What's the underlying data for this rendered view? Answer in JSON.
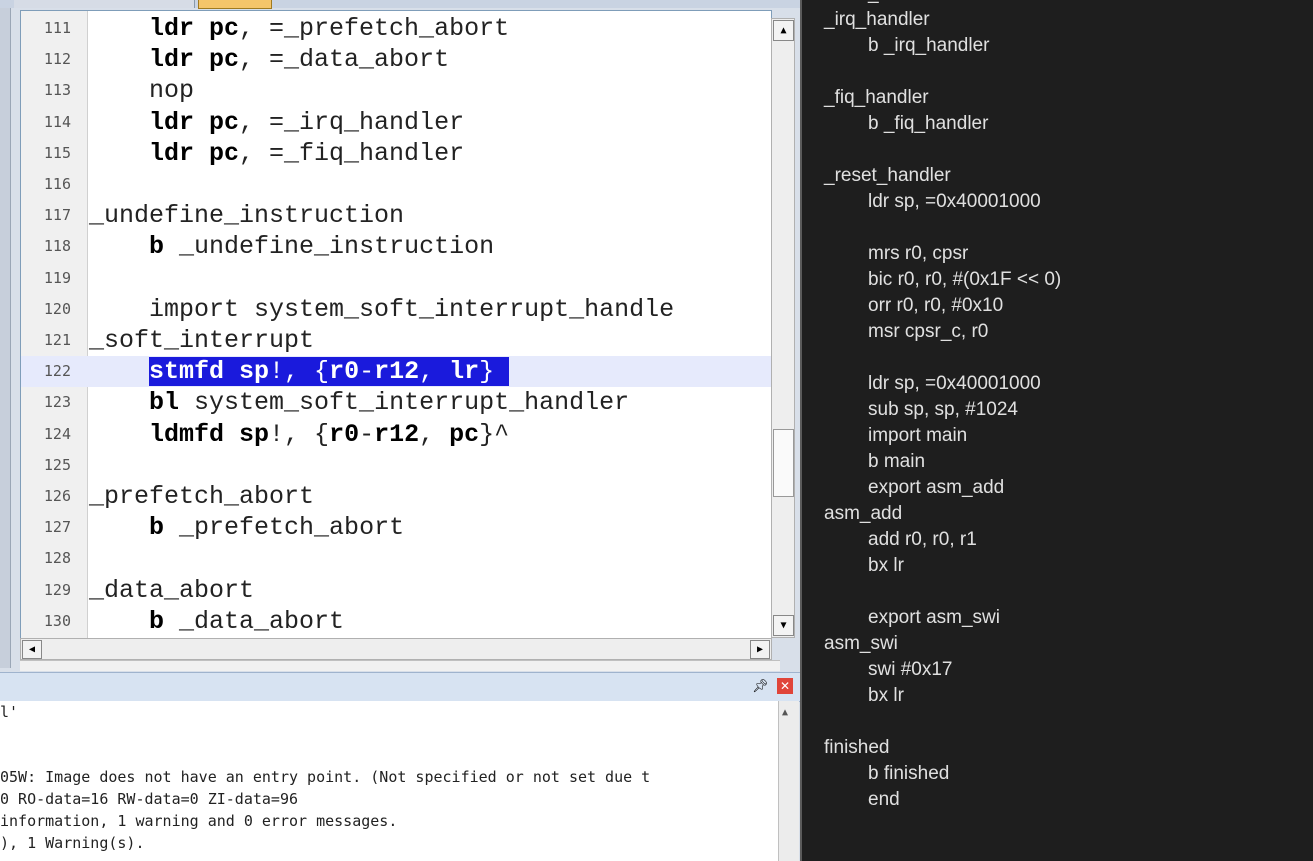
{
  "editor": {
    "lines": [
      {
        "num": "111",
        "html": "    <b>ldr pc</b>, =_prefetch_abort"
      },
      {
        "num": "112",
        "html": "    <b>ldr pc</b>, =_data_abort"
      },
      {
        "num": "113",
        "html": "    nop"
      },
      {
        "num": "114",
        "html": "    <b>ldr pc</b>, =_irq_handler"
      },
      {
        "num": "115",
        "html": "    <b>ldr pc</b>, =_fiq_handler"
      },
      {
        "num": "116",
        "html": ""
      },
      {
        "num": "117",
        "html": "_undefine_instruction"
      },
      {
        "num": "118",
        "html": "    <b>b</b> _undefine_instruction"
      },
      {
        "num": "119",
        "html": ""
      },
      {
        "num": "120",
        "html": "    import system_soft_interrupt_handle"
      },
      {
        "num": "121",
        "html": "_soft_interrupt"
      },
      {
        "num": "122",
        "html": "    <span class=\"sel\"><b>stmfd sp</b>!, {<b>r0</b>-<b>r12</b>, <b>lr</b>} </span>"
      },
      {
        "num": "123",
        "html": "    <b>bl</b> system_soft_interrupt_handler"
      },
      {
        "num": "124",
        "html": "    <b>ldmfd sp</b>!, {<b>r0</b>-<b>r12</b>, <b>pc</b>}^"
      },
      {
        "num": "125",
        "html": ""
      },
      {
        "num": "126",
        "html": "_prefetch_abort"
      },
      {
        "num": "127",
        "html": "    <b>b</b> _prefetch_abort"
      },
      {
        "num": "128",
        "html": ""
      },
      {
        "num": "129",
        "html": "_data_abort"
      },
      {
        "num": "130",
        "html": "    <b>b</b> _data_abort"
      }
    ]
  },
  "build_output": {
    "lines": [
      "l'",
      "",
      "",
      "05W: Image does not have an entry point. (Not specified or not set due t",
      "0 RO-data=16 RW-data=0 ZI-data=96",
      "information, 1 warning and 0 error messages.",
      "), 1 Warning(s)."
    ]
  },
  "notes": {
    "lines": [
      {
        "indent": 1,
        "text": "_"
      },
      {
        "indent": 0,
        "text": "_irq_handler"
      },
      {
        "indent": 1,
        "text": "b _irq_handler"
      },
      {
        "indent": 0,
        "text": ""
      },
      {
        "indent": 0,
        "text": "_fiq_handler"
      },
      {
        "indent": 1,
        "text": "b _fiq_handler"
      },
      {
        "indent": 0,
        "text": ""
      },
      {
        "indent": 0,
        "text": "_reset_handler"
      },
      {
        "indent": 1,
        "text": "ldr sp, =0x40001000"
      },
      {
        "indent": 0,
        "text": ""
      },
      {
        "indent": 1,
        "text": "mrs r0, cpsr"
      },
      {
        "indent": 1,
        "text": "bic r0, r0, #(0x1F << 0)"
      },
      {
        "indent": 1,
        "text": "orr r0, r0, #0x10"
      },
      {
        "indent": 1,
        "text": "msr cpsr_c, r0"
      },
      {
        "indent": 0,
        "text": ""
      },
      {
        "indent": 1,
        "text": "ldr sp, =0x40001000"
      },
      {
        "indent": 1,
        "text": "sub sp, sp, #1024"
      },
      {
        "indent": 1,
        "text": "import main"
      },
      {
        "indent": 1,
        "text": "b main"
      },
      {
        "indent": 1,
        "text": "export asm_add"
      },
      {
        "indent": 0,
        "text": "asm_add"
      },
      {
        "indent": 1,
        "text": "add r0, r0, r1"
      },
      {
        "indent": 1,
        "text": "bx lr"
      },
      {
        "indent": 0,
        "text": ""
      },
      {
        "indent": 1,
        "text": "export asm_swi"
      },
      {
        "indent": 0,
        "text": "asm_swi"
      },
      {
        "indent": 1,
        "text": "swi #0x17"
      },
      {
        "indent": 1,
        "text": "bx lr"
      },
      {
        "indent": 0,
        "text": ""
      },
      {
        "indent": 0,
        "text": "finished"
      },
      {
        "indent": 1,
        "text": "b finished"
      },
      {
        "indent": 1,
        "text": "end"
      }
    ]
  },
  "current_line": "122"
}
